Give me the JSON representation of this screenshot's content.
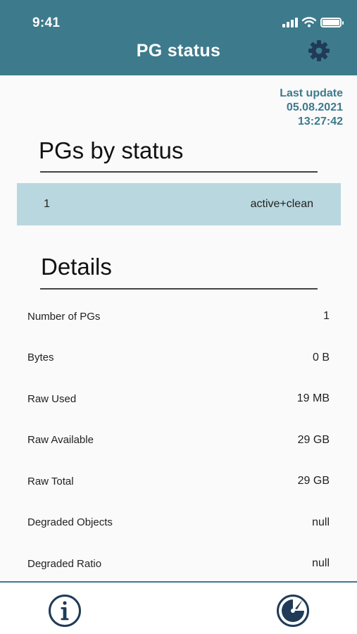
{
  "status_bar": {
    "time": "9:41"
  },
  "header": {
    "title": "PG status"
  },
  "last_update": {
    "label": "Last update",
    "date": "05.08.2021",
    "time": "13:27:42"
  },
  "pgs_by_status": {
    "title": "PGs by status",
    "rows": [
      {
        "count": "1",
        "state": "active+clean"
      }
    ]
  },
  "details": {
    "title": "Details",
    "rows": [
      {
        "label": "Number of PGs",
        "value": "1"
      },
      {
        "label": "Bytes",
        "value": "0 B"
      },
      {
        "label": "Raw Used",
        "value": "19 MB"
      },
      {
        "label": "Raw Available",
        "value": "29 GB"
      },
      {
        "label": "Raw Total",
        "value": "29 GB"
      },
      {
        "label": "Degraded Objects",
        "value": "null"
      },
      {
        "label": "Degraded Ratio",
        "value": "null"
      }
    ]
  },
  "icons": {
    "settings": "gear-icon",
    "info": "info-icon",
    "dashboard": "dashboard-gauge-icon",
    "signal": "signal-icon",
    "wifi": "wifi-icon",
    "battery": "battery-icon"
  },
  "colors": {
    "header": "#3d7a8c",
    "accent_text": "#3d7a8c",
    "highlight_row": "#b9d7df",
    "icon_dark": "#1f3b58"
  }
}
